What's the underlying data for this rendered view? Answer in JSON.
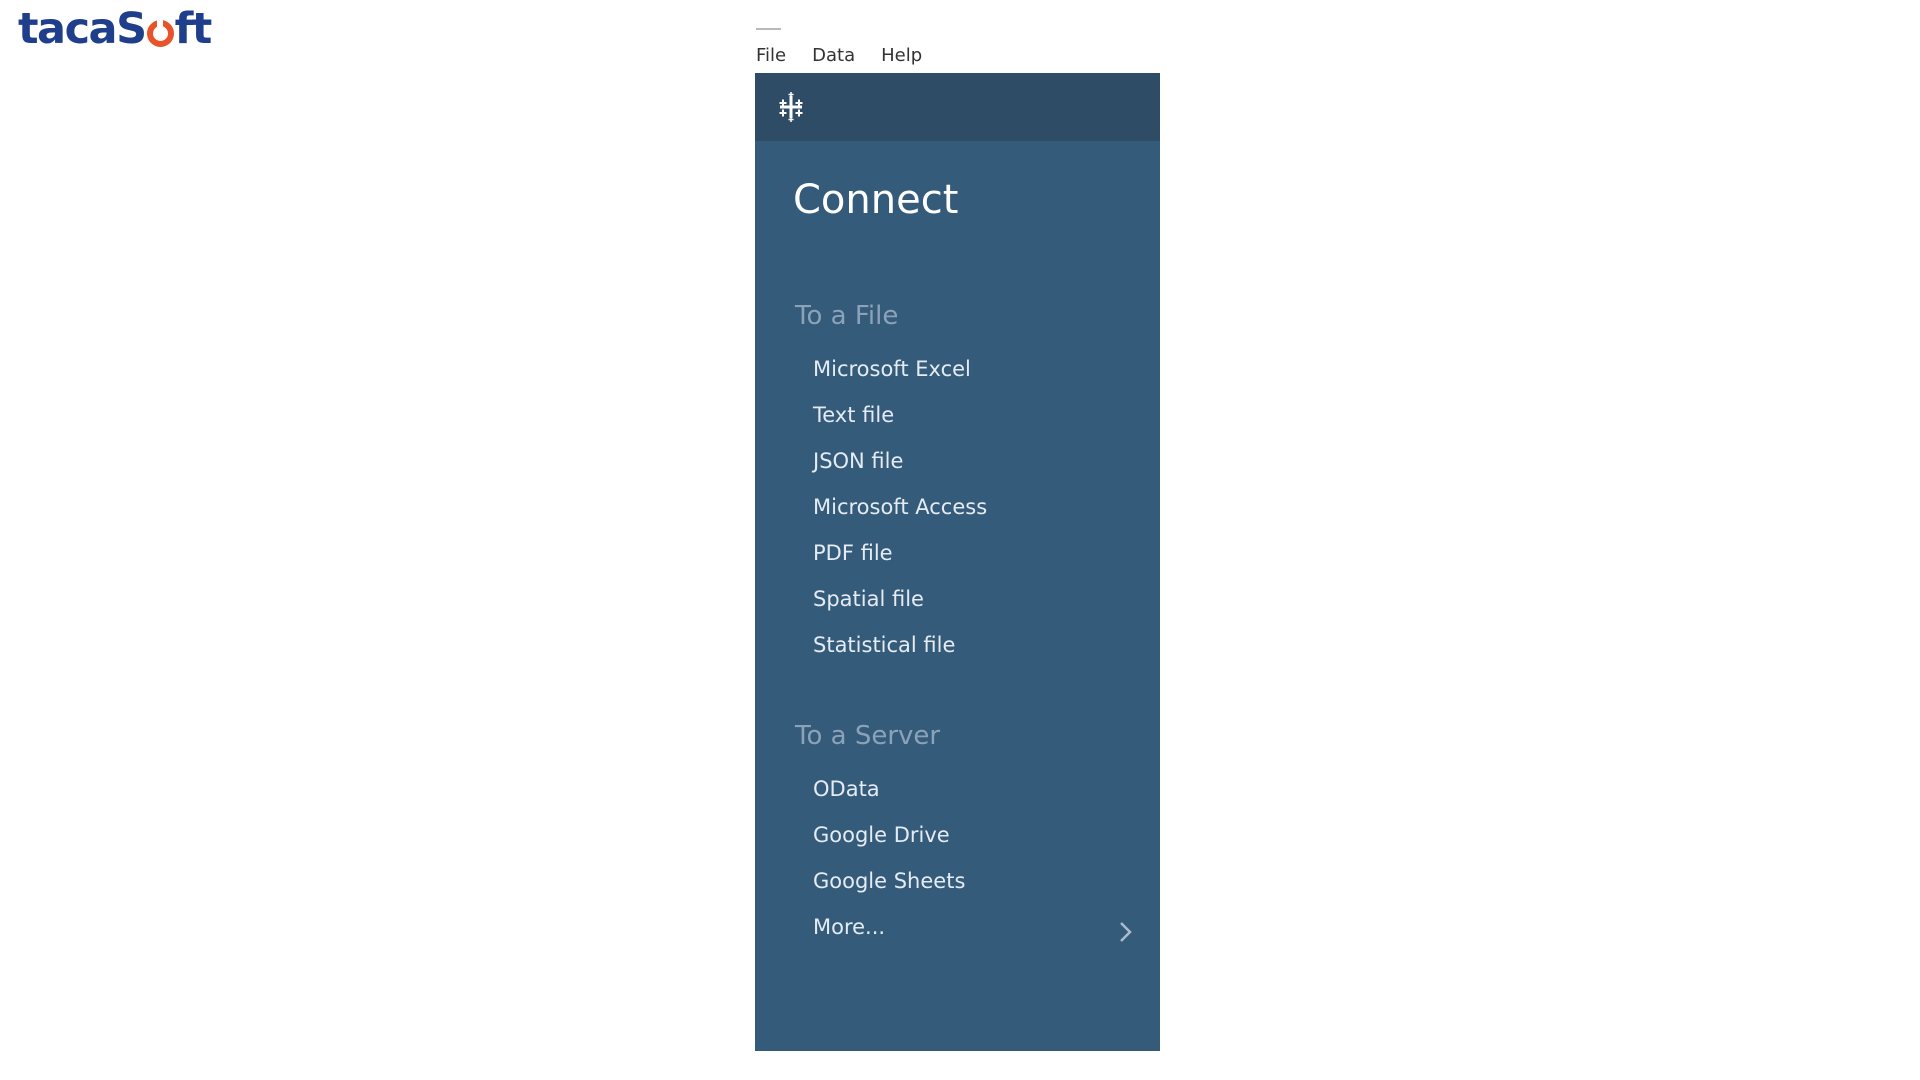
{
  "logo": {
    "text_before": "taca",
    "text_s": "S",
    "text_after": "ft",
    "primary_color": "#1f3e8c",
    "accent_color": "#e8532a"
  },
  "menubar": {
    "items": [
      {
        "label": "File"
      },
      {
        "label": "Data"
      },
      {
        "label": "Help"
      }
    ]
  },
  "panel": {
    "icon": "tableau-logo-icon",
    "title": "Connect",
    "background": "#355b7b",
    "sections": [
      {
        "heading": "To a File",
        "items": [
          {
            "label": "Microsoft Excel"
          },
          {
            "label": "Text file"
          },
          {
            "label": "JSON file"
          },
          {
            "label": "Microsoft Access"
          },
          {
            "label": "PDF file"
          },
          {
            "label": "Spatial file"
          },
          {
            "label": "Statistical file"
          }
        ]
      },
      {
        "heading": "To a Server",
        "items": [
          {
            "label": "OData"
          },
          {
            "label": "Google Drive"
          },
          {
            "label": "Google Sheets"
          },
          {
            "label": "More...",
            "icon": "chevron-right-icon"
          }
        ]
      }
    ]
  }
}
